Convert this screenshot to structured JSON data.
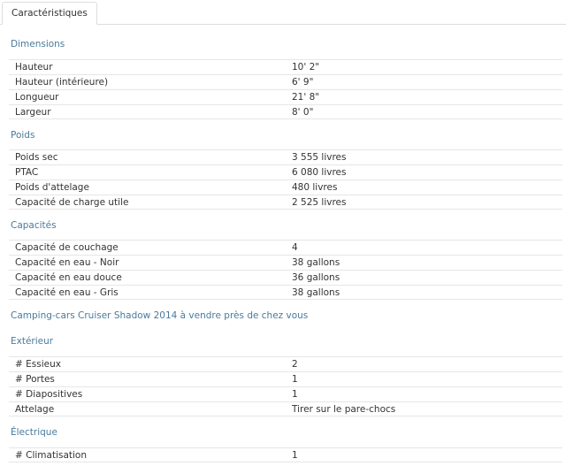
{
  "tab": {
    "label": "Caractéristiques"
  },
  "dimensions": {
    "title": "Dimensions",
    "rows": [
      {
        "label": "Hauteur",
        "value": "10' 2\""
      },
      {
        "label": "Hauteur (intérieure)",
        "value": "6' 9\""
      },
      {
        "label": "Longueur",
        "value": "21' 8\""
      },
      {
        "label": "Largeur",
        "value": "8' 0\""
      }
    ]
  },
  "poids": {
    "title": "Poids",
    "rows": [
      {
        "label": "Poids sec",
        "value": "3 555 livres"
      },
      {
        "label": "PTAC",
        "value": "6 080 livres"
      },
      {
        "label": "Poids d'attelage",
        "value": "480 livres"
      },
      {
        "label": "Capacité de charge utile",
        "value": "2 525 livres"
      }
    ]
  },
  "capacites": {
    "title": "Capacités",
    "rows": [
      {
        "label": "Capacité de couchage",
        "value": "4"
      },
      {
        "label": "Capacité en eau - Noir",
        "value": "38 gallons"
      },
      {
        "label": "Capacité en eau douce",
        "value": "36 gallons"
      },
      {
        "label": "Capacité en eau - Gris",
        "value": "38 gallons"
      }
    ]
  },
  "link": {
    "text": "Camping-cars Cruiser Shadow 2014 à vendre près de chez vous"
  },
  "exterieur": {
    "title": "Extérieur",
    "rows": [
      {
        "label": "# Essieux",
        "value": "2"
      },
      {
        "label": "# Portes",
        "value": "1"
      },
      {
        "label": "# Diapositives",
        "value": "1"
      },
      {
        "label": "Attelage",
        "value": "Tirer sur le pare-chocs"
      }
    ]
  },
  "electrique": {
    "title": "Électrique",
    "rows": [
      {
        "label": "# Climatisation",
        "value": "1"
      }
    ]
  }
}
